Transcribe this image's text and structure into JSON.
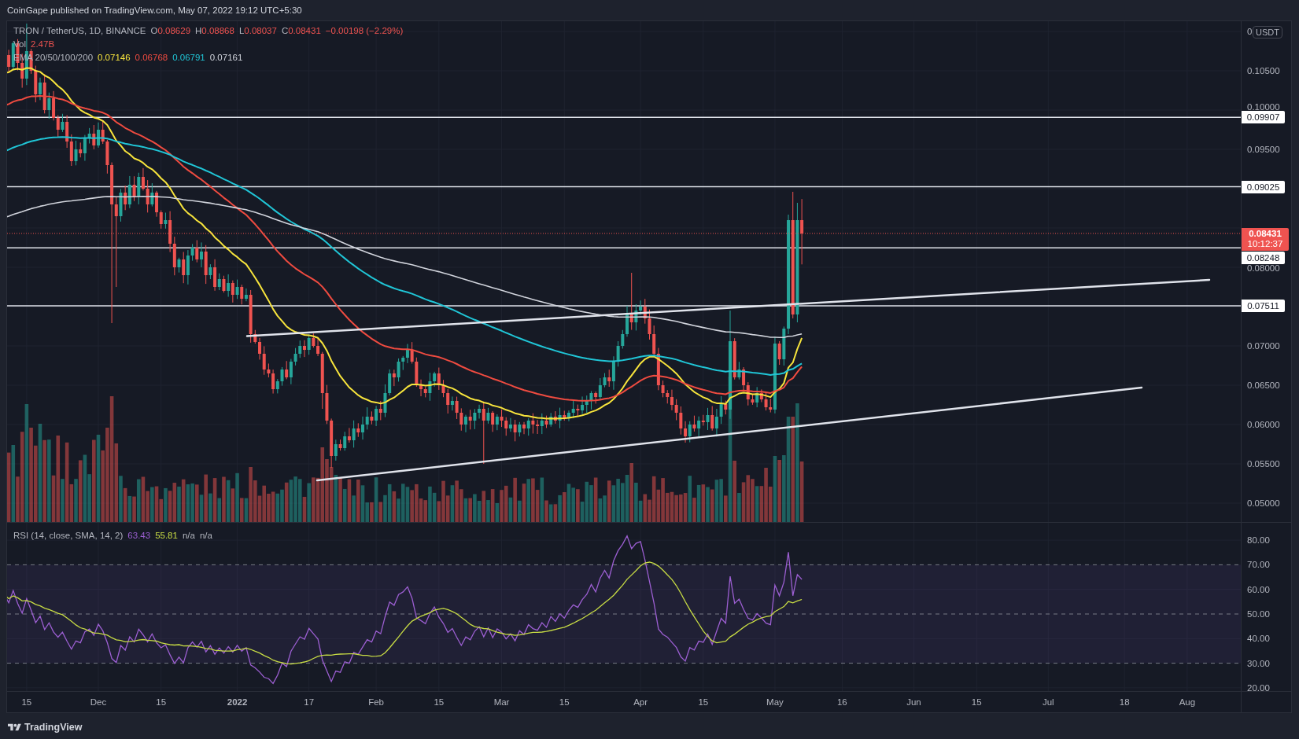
{
  "header": {
    "text": "CoinGape published on TradingView.com, May 07, 2022 19:12 UTC+5:30"
  },
  "legend": {
    "symbol": "TRON / TetherUS, 1D, BINANCE",
    "ohlc": [
      {
        "key": "O",
        "value": "0.08629"
      },
      {
        "key": "H",
        "value": "0.08868"
      },
      {
        "key": "L",
        "value": "0.08037"
      },
      {
        "key": "C",
        "value": "0.08431"
      }
    ],
    "change": "−0.00198 (−2.29%)",
    "volume": {
      "label": "Vol",
      "value": "2.47B"
    },
    "ema": {
      "label": "EMA 20/50/100/200",
      "values": [
        {
          "value": "0.07146",
          "color": "#f7e43c"
        },
        {
          "value": "0.06768",
          "color": "#ef4b40"
        },
        {
          "value": "0.06791",
          "color": "#20c5d6"
        },
        {
          "value": "0.07161",
          "color": "#d1d4dc"
        }
      ]
    }
  },
  "price_axis": {
    "unit": "USDT",
    "ticks": [
      "0",
      "0.10500",
      "0.10000",
      "0.09500",
      "0.08000",
      "0.07000",
      "0.06500",
      "0.06000",
      "0.05500",
      "0.05000"
    ],
    "levels": [
      "0.09907",
      "0.09025",
      "0.08248",
      "0.07511"
    ],
    "last_price": {
      "price": "0.08431",
      "countdown": "10:12:37"
    }
  },
  "rsi": {
    "label": "RSI (14, close, SMA, 14, 2)",
    "values": [
      {
        "value": "63.43",
        "color": "#9c5fd2"
      },
      {
        "value": "55.81",
        "color": "#c8dc44"
      },
      {
        "value": "n/a",
        "color": "#b2b5be"
      },
      {
        "value": "n/a",
        "color": "#b2b5be"
      }
    ],
    "ticks": [
      "80.00",
      "70.00",
      "60.00",
      "50.00",
      "40.00",
      "30.00",
      "20.00"
    ]
  },
  "time_axis": {
    "labels": [
      {
        "text": "15",
        "kind": "day"
      },
      {
        "text": "Dec",
        "kind": "month"
      },
      {
        "text": "15",
        "kind": "day"
      },
      {
        "text": "2022",
        "kind": "year"
      },
      {
        "text": "17",
        "kind": "day"
      },
      {
        "text": "Feb",
        "kind": "month"
      },
      {
        "text": "15",
        "kind": "day"
      },
      {
        "text": "Mar",
        "kind": "month"
      },
      {
        "text": "15",
        "kind": "day"
      },
      {
        "text": "Apr",
        "kind": "month"
      },
      {
        "text": "15",
        "kind": "day"
      },
      {
        "text": "May",
        "kind": "month"
      },
      {
        "text": "16",
        "kind": "day"
      },
      {
        "text": "Jun",
        "kind": "month"
      },
      {
        "text": "15",
        "kind": "day"
      },
      {
        "text": "Jul",
        "kind": "month"
      },
      {
        "text": "18",
        "kind": "day"
      },
      {
        "text": "Aug",
        "kind": "month"
      }
    ]
  },
  "footer": {
    "brand": "TradingView"
  }
}
